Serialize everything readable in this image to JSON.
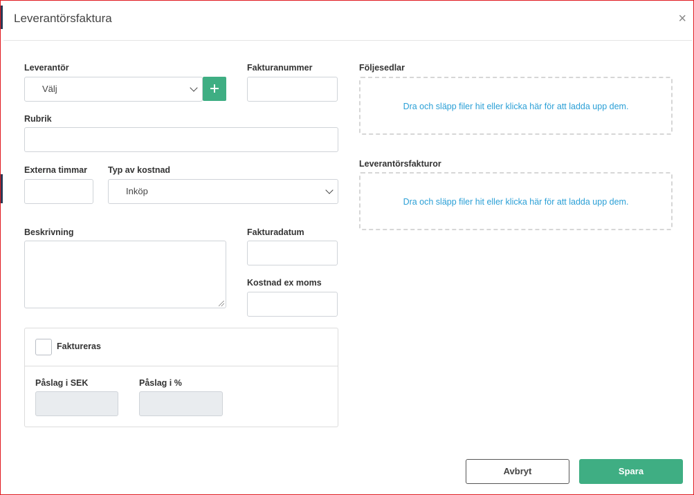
{
  "modal": {
    "title": "Leverantörsfaktura",
    "close_symbol": "×"
  },
  "form": {
    "supplier": {
      "label": "Leverantör",
      "value": "Välj"
    },
    "invoice_number": {
      "label": "Fakturanummer",
      "value": ""
    },
    "subject": {
      "label": "Rubrik",
      "value": ""
    },
    "external_hours": {
      "label": "Externa timmar",
      "value": ""
    },
    "cost_type": {
      "label": "Typ av kostnad",
      "value": "Inköp"
    },
    "description": {
      "label": "Beskrivning",
      "value": ""
    },
    "invoice_date": {
      "label": "Fakturadatum",
      "value": ""
    },
    "cost_ex_vat": {
      "label": "Kostnad ex moms",
      "value": ""
    },
    "billable": {
      "label": "Faktureras",
      "checked": false
    },
    "markup_sek": {
      "label": "Påslag i SEK",
      "value": ""
    },
    "markup_percent": {
      "label": "Påslag i %",
      "value": ""
    }
  },
  "attachments": {
    "delivery_notes": {
      "label": "Följesedlar",
      "dropzone_text": "Dra och släpp filer hit eller klicka här för att ladda upp dem."
    },
    "supplier_invoices": {
      "label": "Leverantörsfakturor",
      "dropzone_text": "Dra och släpp filer hit eller klicka här för att ladda upp dem."
    }
  },
  "footer": {
    "cancel_label": "Avbryt",
    "save_label": "Spara"
  },
  "colors": {
    "accent": "#3fae83",
    "link": "#2a9fd6",
    "frame_border": "#e0191f"
  }
}
